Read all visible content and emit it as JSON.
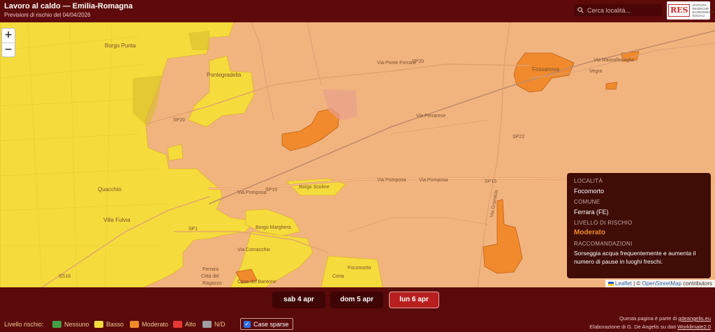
{
  "header": {
    "title": "Lavoro al caldo — Emilia-Romagna",
    "subtitle": "Previsioni di rischio del 04/04/2026",
    "search_placeholder": "Cerca località...",
    "logo_mark": "RES",
    "logo_lines": [
      "ISTITUTO",
      "RICERCHE",
      "ECONOMICHE",
      "SOCIALI"
    ]
  },
  "map": {
    "zoom_in": "+",
    "zoom_out": "−",
    "labels": {
      "borgo_punta": "Borgo Punta",
      "pontegradella": "Pontegradella",
      "sp20_top": "SP20",
      "sp20_left": "SP20",
      "via_ponte_ferrara": "Via Ponte Ferrara",
      "via_pomposa_top": "Via Pomposa",
      "via_pomposa_mid": "Via Pomposa",
      "via_pomposa_left": "Via Pomposa",
      "sp15_left": "SP15",
      "sp15_right": "SP15",
      "sp22": "SP22",
      "sp1": "SP1",
      "ss16": "SS16",
      "quacchio": "Quacchio",
      "villa_fulvia": "Villa Fulvia",
      "borgo_scoline": "Borgo Scoline",
      "borgo_marghera": "Borgo Marghera",
      "via_comacchio": "Via Comacchio",
      "ferrara_citta": "Ferrara",
      "citta_del": "Città del",
      "ragazzo": "Ragazzo",
      "casaglia": "Casa del Bantone",
      "cona": "Cona",
      "focomorto_map": "Focomorto",
      "via_maiella": "Via Massafiscaglia",
      "vegra": "Vegra",
      "fossanova": "Fossanova",
      "via_ferrarese": "Via Ferrarese",
      "via_gramicia": "Via Gramicia"
    },
    "info_panel": {
      "locality_label": "LOCALITÀ",
      "locality": "Focomorto",
      "municipality_label": "COMUNE",
      "municipality": "Ferrara (FE)",
      "risk_label": "LIVELLO DI RISCHIO",
      "risk": "Moderato",
      "recommendations_label": "RACCOMANDAZIONI",
      "recommendations": "Sorseggia acqua frequentemente e aumenta il numero di pause in luoghi freschi."
    },
    "attribution": {
      "leaflet": "Leaflet",
      "separator": " | © ",
      "osm": "OpenStreetMap",
      "contributors": " contributors"
    }
  },
  "days": [
    {
      "label": "sab 4 apr",
      "active": false
    },
    {
      "label": "dom 5 apr",
      "active": false
    },
    {
      "label": "lun 6 apr",
      "active": true
    }
  ],
  "legend": {
    "title": "Livello rischio:",
    "items": [
      {
        "label": "Nessuno",
        "color": "#43a047"
      },
      {
        "label": "Basso",
        "color": "#f5dc3c"
      },
      {
        "label": "Moderato",
        "color": "#f08a2c"
      },
      {
        "label": "Alto",
        "color": "#e53935"
      },
      {
        "label": "N/D",
        "color": "#9e9e9e"
      }
    ],
    "case_sparse": "Case sparse",
    "case_sparse_checked": true
  },
  "credits": {
    "line1_prefix": "Questa pagina è parte di ",
    "line1_link": "gdeangelis.eu",
    "line2_prefix": "Elaborazione di G. De Angelis su dati ",
    "line2_link": "Worklimate2.0"
  },
  "colors": {
    "header_bg": "#5e0a0a",
    "map_base": "#f2b47e",
    "low_risk": "#f5dc3c",
    "moderate_risk": "#f08a2c",
    "active_day": "#b81f1f"
  }
}
